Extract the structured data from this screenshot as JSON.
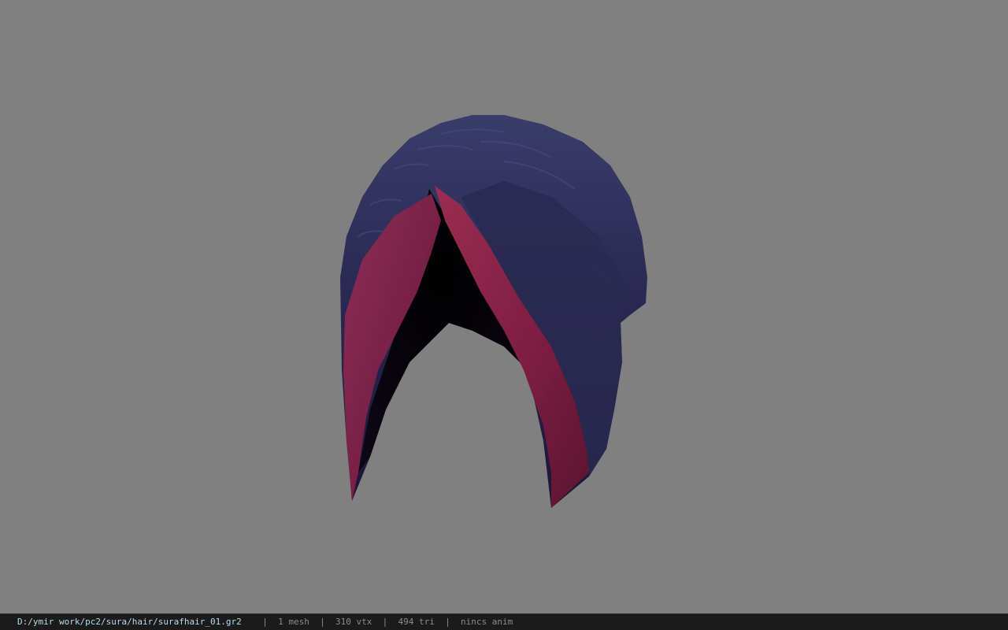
{
  "viewport": {
    "background_color": "#808080",
    "object": "hair-mesh"
  },
  "statusbar": {
    "file_path": "D:/ymir work/pc2/sura/hair/surafhair_01.gr2",
    "mesh_count": "1 mesh",
    "vertex_count": "310 vtx",
    "triangle_count": "494 tri",
    "anim_label": "nincs anim",
    "separator": "|",
    "colors": {
      "background": "#1b1b1b",
      "path_text": "#b9dcec",
      "info_text": "#8d8d8d"
    }
  }
}
